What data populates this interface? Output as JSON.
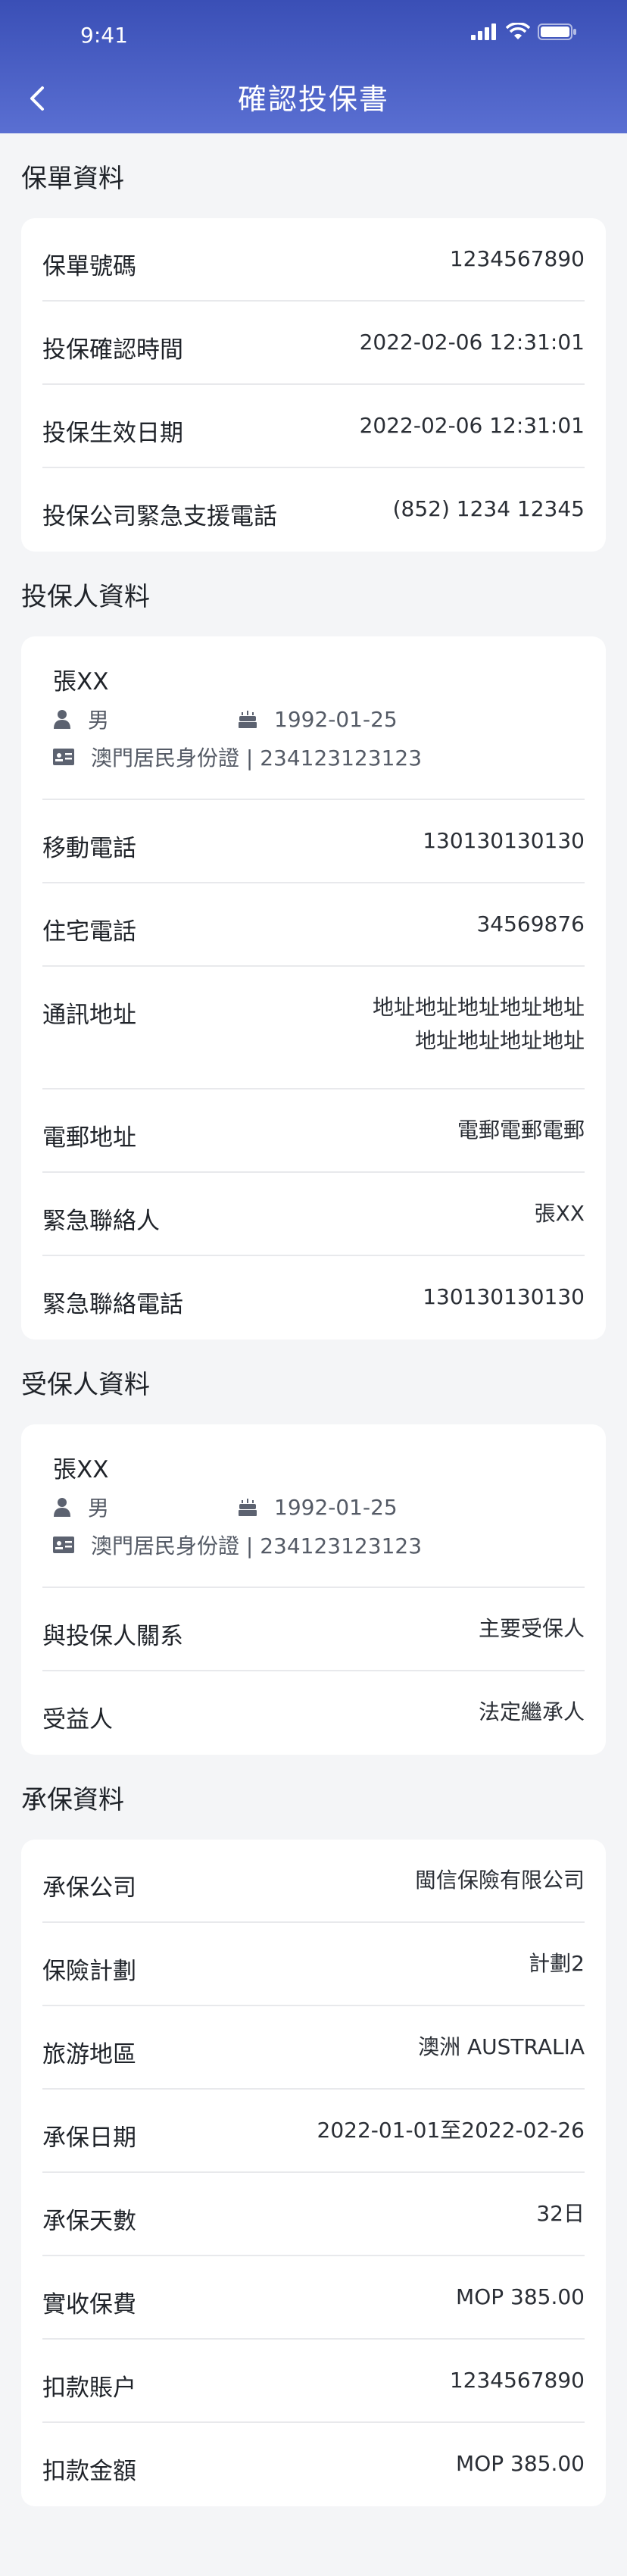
{
  "status": {
    "time": "9:41"
  },
  "header": {
    "title": "確認投保書"
  },
  "policy": {
    "title": "保單資料",
    "rows": [
      {
        "k": "保單號碼",
        "v": "1234567890"
      },
      {
        "k": "投保確認時間",
        "v": "2022-02-06 12:31:01"
      },
      {
        "k": "投保生效日期",
        "v": "2022-02-06 12:31:01"
      },
      {
        "k": "投保公司緊急支援電話",
        "v": "(852) 1234 12345"
      }
    ]
  },
  "applicant": {
    "title": "投保人資料",
    "name": "張XX",
    "gender": "男",
    "dob": "1992-01-25",
    "id_doc": "澳門居民身份證 | 234123123123",
    "mobile_label": "移動電話",
    "mobile": "130130130130",
    "home_label": "住宅電話",
    "home": "34569876",
    "address_label": "通訊地址",
    "address_line1": "地址地址地址地址地址",
    "address_line2": "地址地址地址地址",
    "email_label": "電郵地址",
    "email": "電郵電郵電郵",
    "contact_label": "緊急聯絡人",
    "contact": "張XX",
    "contact_phone_label": "緊急聯絡電話",
    "contact_phone": "130130130130"
  },
  "insured": {
    "title": "受保人資料",
    "name": "張XX",
    "gender": "男",
    "dob": "1992-01-25",
    "id_doc": "澳門居民身份證 | 234123123123",
    "relation_label": "與投保人關系",
    "relation": "主要受保人",
    "beneficiary_label": "受益人",
    "beneficiary": "法定繼承人"
  },
  "coverage": {
    "title": "承保資料",
    "rows": [
      {
        "k": "承保公司",
        "v": "閩信保險有限公司"
      },
      {
        "k": "保險計劃",
        "v": "計劃2"
      },
      {
        "k": "旅游地區",
        "v": "澳洲 AUSTRALIA"
      },
      {
        "k": "承保日期",
        "v": "2022-01-01至2022-02-26"
      },
      {
        "k": "承保天數",
        "v": "32日"
      },
      {
        "k": "實收保費",
        "v": "MOP 385.00"
      },
      {
        "k": "扣款賬户",
        "v": "1234567890"
      },
      {
        "k": "扣款金額",
        "v": "MOP 385.00"
      }
    ]
  }
}
